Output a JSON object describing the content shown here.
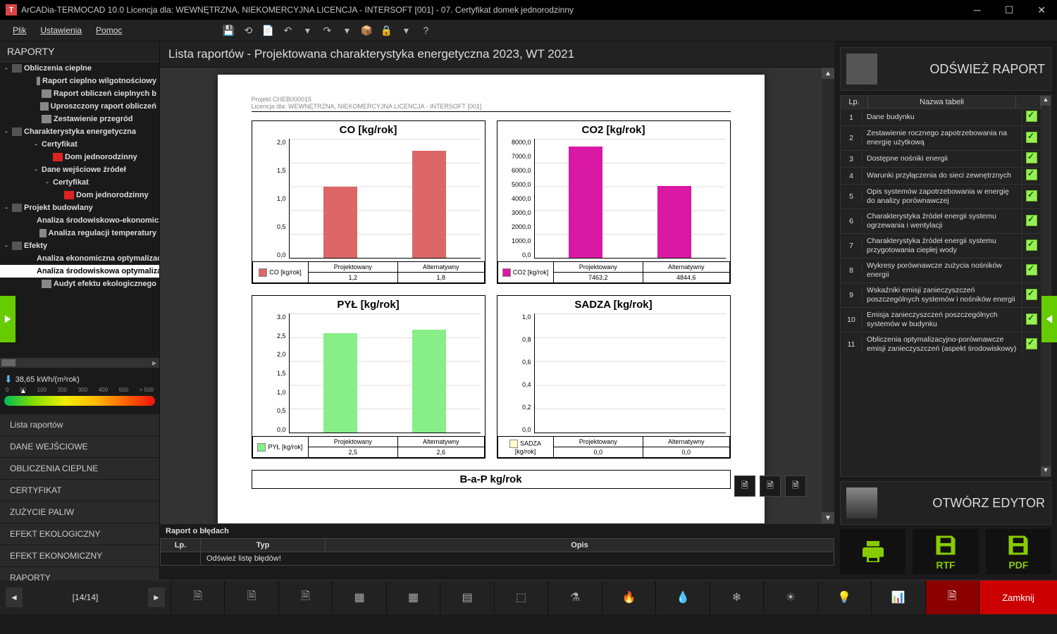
{
  "title": "ArCADia-TERMOCAD 10.0 Licencja dla: WEWNĘTRZNA, NIEKOMERCYJNA LICENCJA - INTERSOFT [001] - 07. Certyfikat domek jednorodzinny",
  "menu": {
    "plik": "Plik",
    "ustawienia": "Ustawienia",
    "pomoc": "Pomoc"
  },
  "sidebar_title": "RAPORTY",
  "tree": [
    {
      "lvl": 0,
      "exp": "-",
      "ico": "folder",
      "txt": "Obliczenia cieplne",
      "bold": true
    },
    {
      "lvl": 2,
      "ico": "page",
      "txt": "Raport cieplno wilgotnościowy",
      "bold": true
    },
    {
      "lvl": 2,
      "ico": "page",
      "txt": "Raport obliczeń cieplnych b",
      "bold": true
    },
    {
      "lvl": 2,
      "ico": "page",
      "txt": "Uproszczony raport obliczeń",
      "bold": true
    },
    {
      "lvl": 2,
      "ico": "page",
      "txt": "Zestawienie przegród",
      "bold": true
    },
    {
      "lvl": 0,
      "exp": "-",
      "ico": "folder",
      "txt": "Charakterystyka energetyczna",
      "bold": true
    },
    {
      "lvl": 2,
      "exp": "-",
      "txt": "Certyfikat",
      "bold": true
    },
    {
      "lvl": 3,
      "ico": "flag",
      "txt": "Dom jednorodzinny",
      "bold": true
    },
    {
      "lvl": 2,
      "exp": "-",
      "txt": "Dane wejściowe źródeł",
      "bold": true
    },
    {
      "lvl": 3,
      "exp": "-",
      "txt": "Certyfikat",
      "bold": true
    },
    {
      "lvl": 4,
      "ico": "flag",
      "txt": "Dom jednorodzinny",
      "bold": true
    },
    {
      "lvl": 0,
      "exp": "-",
      "ico": "folder",
      "txt": "Projekt budowlany",
      "bold": true
    },
    {
      "lvl": 2,
      "ico": "page",
      "txt": "Analiza środowiskowo-ekonomiczna",
      "bold": true
    },
    {
      "lvl": 2,
      "ico": "page",
      "txt": "Analiza regulacji temperatury",
      "bold": true
    },
    {
      "lvl": 0,
      "exp": "-",
      "ico": "folder",
      "txt": "Efekty",
      "bold": true
    },
    {
      "lvl": 2,
      "ico": "page",
      "txt": "Analiza ekonomiczna optymalizacji",
      "bold": true
    },
    {
      "lvl": 2,
      "ico": "page",
      "txt": "Analiza środowiskowa optymalizacji",
      "bold": true,
      "sel": true
    },
    {
      "lvl": 2,
      "ico": "page",
      "txt": "Audyt efektu ekologicznego",
      "bold": true
    }
  ],
  "energy": {
    "value": "38,65 kWh/(m²rok)",
    "ticks": [
      "0",
      "50",
      "100",
      "200",
      "300",
      "400",
      "500",
      "> 500"
    ]
  },
  "sidenav": [
    "Lista raportów",
    "DANE WEJŚCIOWE",
    "OBLICZENIA CIEPLNE",
    "CERTYFIKAT",
    "ZUŻYCIE PALIW",
    "EFEKT EKOLOGICZNY",
    "EFEKT EKONOMICZNY",
    "RAPORTY"
  ],
  "main_header": "Lista raportów - Projektowana charakterystyka energetyczna 2023, WT 2021",
  "doc": {
    "proj": "Projekt CHEB000015",
    "lic": "Licencja dla: WEWNĘTRZNA, NIEKOMERCYJNA LICENCJA - INTERSOFT [001]"
  },
  "chart_data": [
    {
      "type": "bar",
      "title": "CO [kg/rok]",
      "categories": [
        "Projektowany",
        "Alternatywny"
      ],
      "values": [
        1.2,
        1.8
      ],
      "ylim": [
        0,
        2.0
      ],
      "yticks": [
        "0,0",
        "0,5",
        "1,0",
        "1,5",
        "2,0"
      ],
      "legend": "CO [kg/rok]",
      "color": "#d66",
      "disp": [
        "1,2",
        "1,8"
      ]
    },
    {
      "type": "bar",
      "title": "CO2 [kg/rok]",
      "categories": [
        "Projektowany",
        "Alternatywny"
      ],
      "values": [
        7463.2,
        4844.6
      ],
      "ylim": [
        0,
        8000
      ],
      "yticks": [
        "0,0",
        "1000,0",
        "2000,0",
        "3000,0",
        "4000,0",
        "5000,0",
        "6000,0",
        "7000,0",
        "8000,0"
      ],
      "legend": "CO2 [kg/rok]",
      "color": "#d919a3",
      "disp": [
        "7463,2",
        "4844,6"
      ]
    },
    {
      "type": "bar",
      "title": "PYŁ [kg/rok]",
      "categories": [
        "Projektowany",
        "Alternatywny"
      ],
      "values": [
        2.5,
        2.6
      ],
      "ylim": [
        0,
        3.0
      ],
      "yticks": [
        "0,0",
        "0,5",
        "1,0",
        "1,5",
        "2,0",
        "2,5",
        "3,0"
      ],
      "legend": "PYŁ [kg/rok]",
      "color": "#8e8",
      "disp": [
        "2,5",
        "2,6"
      ]
    },
    {
      "type": "bar",
      "title": "SADZA [kg/rok]",
      "categories": [
        "Projektowany",
        "Alternatywny"
      ],
      "values": [
        0.0,
        0.0
      ],
      "ylim": [
        0,
        1.0
      ],
      "yticks": [
        "0,0",
        "0,2",
        "0,4",
        "0,6",
        "0,8",
        "1,0"
      ],
      "legend": "SADZA [kg/rok]",
      "color": "#ffc",
      "disp": [
        "0,0",
        "0,0"
      ]
    }
  ],
  "next_chart_peek": "B-a-P kg/rok",
  "right": {
    "refresh": "ODŚWIEŻ RAPORT",
    "editor": "OTWÓRZ EDYTOR",
    "table_head": {
      "lp": "Lp.",
      "name": "Nazwa tabeli"
    },
    "rows": [
      {
        "n": "1",
        "t": "Dane budynku"
      },
      {
        "n": "2",
        "t": "Zestawienie rocznego zapotrzebowania na energię użytkową"
      },
      {
        "n": "3",
        "t": "Dostępne nośniki energii"
      },
      {
        "n": "4",
        "t": "Warunki przyłączenia do sieci zewnętrznych"
      },
      {
        "n": "5",
        "t": "Opis systemów zapotrzebowania w energię do analizy porównawczej"
      },
      {
        "n": "6",
        "t": "Charakterystyka źródeł energii systemu ogrzewania i wentylacji"
      },
      {
        "n": "7",
        "t": "Charakterystyka źródeł energii systemu przygotowania ciepłej wody"
      },
      {
        "n": "8",
        "t": "Wykresy porównawcze zużycia nośników energii"
      },
      {
        "n": "9",
        "t": "Wskaźniki emisji zanieczyszczeń poszczególnych systemów i nośników energii"
      },
      {
        "n": "10",
        "t": "Emisja zanieczyszczeń poszczególnych systemów w budynku"
      },
      {
        "n": "11",
        "t": "Obliczenia optymalizacyjno-porównawcze emisji zanieczyszczeń (aspekt środowiskowy)"
      }
    ],
    "export": {
      "rtf": "RTF",
      "pdf": "PDF"
    }
  },
  "errors": {
    "title": "Raport o błędach",
    "cols": {
      "lp": "Lp.",
      "typ": "Typ",
      "opis": "Opis"
    },
    "row": "Odśwież listę błędów!"
  },
  "pager": "[14/14]",
  "close": "Zamknij"
}
